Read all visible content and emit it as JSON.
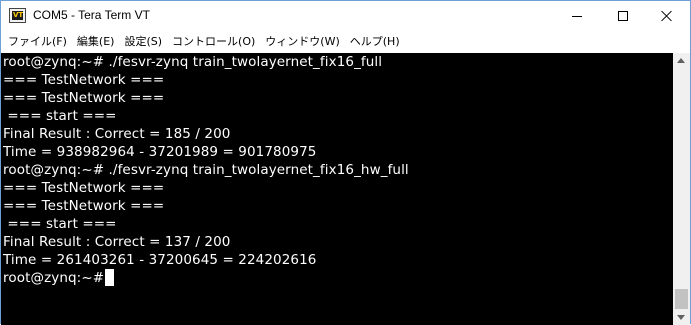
{
  "window": {
    "title": "COM5 - Tera Term VT",
    "icon": "teraterm-vt-icon",
    "icon_text": "VT"
  },
  "controls": {
    "minimize": "minimize-icon",
    "maximize": "maximize-icon",
    "close": "close-icon"
  },
  "menu": [
    {
      "label": "ファイル(F)"
    },
    {
      "label": "編集(E)"
    },
    {
      "label": "設定(S)"
    },
    {
      "label": "コントロール(O)"
    },
    {
      "label": "ウィンドウ(W)"
    },
    {
      "label": "ヘルプ(H)"
    }
  ],
  "terminal": {
    "background": "#000000",
    "foreground": "#ffffff",
    "lines": [
      "root@zynq:~# ./fesvr-zynq train_twolayernet_fix16_full",
      "=== TestNetwork ===",
      "=== TestNetwork ===",
      " === start ===",
      "Final Result : Correct = 185 / 200",
      "Time = 938982964 - 37201989 = 901780975",
      "root@zynq:~# ./fesvr-zynq train_twolayernet_fix16_hw_full",
      "=== TestNetwork ===",
      "=== TestNetwork ===",
      " === start ===",
      "Final Result : Correct = 137 / 200",
      "Time = 261403261 - 37200645 = 224202616",
      "root@zynq:~# "
    ]
  }
}
